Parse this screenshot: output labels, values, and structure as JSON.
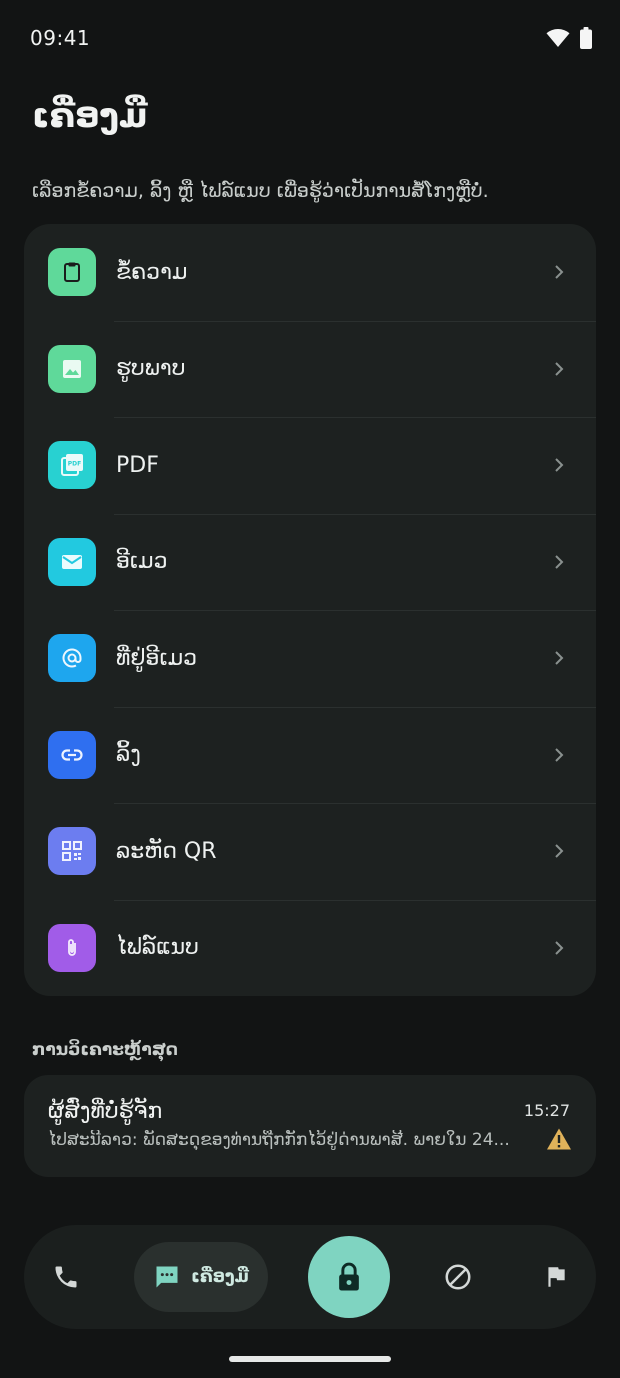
{
  "status_bar": {
    "time": "09:41"
  },
  "header": {
    "title": "ເຄື່ອງມື",
    "subtitle": "ເລືອກຂໍ້ຄວາມ, ລິ້ງ ຫຼື ໄຟລ໌ແນບ ເພື່ອຮູ້ວ່າເປັນການສໍ້ໂກງຫຼືບໍ່."
  },
  "tools": [
    {
      "label": "ຂໍ້ຄວາມ",
      "icon": "clipboard-icon",
      "color": "#5fd99a"
    },
    {
      "label": "ຮູບພາບ",
      "icon": "image-icon",
      "color": "#5fd99a"
    },
    {
      "label": "PDF",
      "icon": "pdf-icon",
      "color": "#28d1d1"
    },
    {
      "label": "ອີເມວ",
      "icon": "mail-icon",
      "color": "#22c9e0"
    },
    {
      "label": "ທີ່ຢູ່ອີເມວ",
      "icon": "at-icon",
      "color": "#1ea6ee"
    },
    {
      "label": "ລິ້ງ",
      "icon": "link-icon",
      "color": "#2f6ff0"
    },
    {
      "label": "ລະຫັດ QR",
      "icon": "qr-code-icon",
      "color": "#6c7df0"
    },
    {
      "label": "ໄຟລ໌ແນບ",
      "icon": "paperclip-icon",
      "color": "#a15ce8"
    }
  ],
  "recent": {
    "section_title": "ການວິເຄາະຫຼ້າສຸດ",
    "items": [
      {
        "sender": "ຜູ້ສົ່ງທີ່ບໍ່ຮູ້ຈັກ",
        "preview": "ໄປສະນີລາວ: ພັດສະດຸຂອງທ່ານຖືກກັກໄວ້ຢູ່ດ່ານພາສີ. ພາຍໃນ 24...",
        "time": "15:27",
        "status_icon": "warning-icon",
        "status_color": "#e0b25a"
      }
    ]
  },
  "bottom_nav": {
    "items": [
      {
        "icon": "phone-icon"
      },
      {
        "icon": "message-icon",
        "label": "ເຄື່ອງມື",
        "active": true
      },
      {
        "icon": "lock-icon"
      },
      {
        "icon": "block-icon"
      },
      {
        "icon": "flag-icon"
      }
    ]
  },
  "colors": {
    "background": "#121414",
    "card": "#1d2120",
    "accent": "#7fd4c1"
  }
}
